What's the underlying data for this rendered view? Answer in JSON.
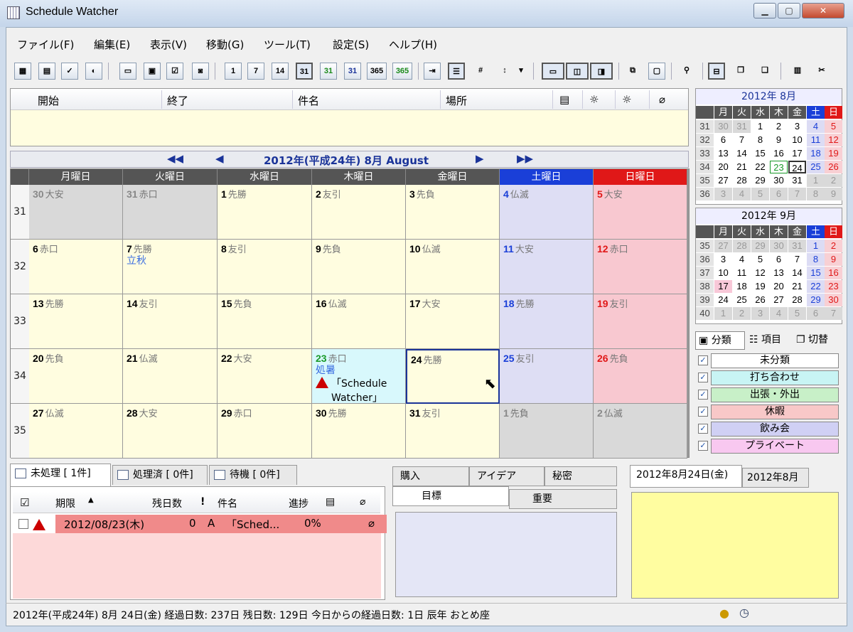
{
  "window": {
    "title": "Schedule Watcher",
    "min": "▁",
    "max": "▢",
    "close": "✕"
  },
  "menu": [
    "ファイル(F)",
    "編集(E)",
    "表示(V)",
    "移動(G)",
    "ツール(T)",
    "設定(S)",
    "ヘルプ(H)"
  ],
  "toolbar": [
    "1",
    "7",
    "14",
    "31",
    "31",
    "31",
    "365",
    "365"
  ],
  "eventlist": {
    "headers": [
      "開始",
      "終了",
      "件名",
      "場所"
    ]
  },
  "nav": {
    "title": "2012年(平成24年) 8月 August",
    "prev_year": "◀◀",
    "prev": "◀",
    "next": "▶",
    "next_year": "▶▶"
  },
  "calendar": {
    "weekdays": [
      "月曜日",
      "火曜日",
      "水曜日",
      "木曜日",
      "金曜日",
      "土曜日",
      "日曜日"
    ],
    "weeks": [
      "31",
      "32",
      "33",
      "34",
      "35"
    ],
    "days": [
      [
        {
          "n": "30",
          "r": "大安"
        },
        {
          "n": "31",
          "r": "赤口"
        },
        {
          "n": "1",
          "r": "先勝"
        },
        {
          "n": "2",
          "r": "友引"
        },
        {
          "n": "3",
          "r": "先負"
        },
        {
          "n": "4",
          "r": "仏滅"
        },
        {
          "n": "5",
          "r": "大安"
        }
      ],
      [
        {
          "n": "6",
          "r": "赤口"
        },
        {
          "n": "7",
          "r": "先勝",
          "h": "立秋"
        },
        {
          "n": "8",
          "r": "友引"
        },
        {
          "n": "9",
          "r": "先負"
        },
        {
          "n": "10",
          "r": "仏滅"
        },
        {
          "n": "11",
          "r": "大安"
        },
        {
          "n": "12",
          "r": "赤口"
        }
      ],
      [
        {
          "n": "13",
          "r": "先勝"
        },
        {
          "n": "14",
          "r": "友引"
        },
        {
          "n": "15",
          "r": "先負"
        },
        {
          "n": "16",
          "r": "仏滅"
        },
        {
          "n": "17",
          "r": "大安"
        },
        {
          "n": "18",
          "r": "先勝"
        },
        {
          "n": "19",
          "r": "友引"
        }
      ],
      [
        {
          "n": "20",
          "r": "先負"
        },
        {
          "n": "21",
          "r": "仏滅"
        },
        {
          "n": "22",
          "r": "大安"
        },
        {
          "n": "23",
          "r": "赤口",
          "h": "処暑",
          "e": "「Schedule",
          "e2": "Watcher」"
        },
        {
          "n": "24",
          "r": "先勝"
        },
        {
          "n": "25",
          "r": "友引"
        },
        {
          "n": "26",
          "r": "先負"
        }
      ],
      [
        {
          "n": "27",
          "r": "仏滅"
        },
        {
          "n": "28",
          "r": "大安"
        },
        {
          "n": "29",
          "r": "赤口"
        },
        {
          "n": "30",
          "r": "先勝"
        },
        {
          "n": "31",
          "r": "友引"
        },
        {
          "n": "1",
          "r": "先負"
        },
        {
          "n": "2",
          "r": "仏滅"
        }
      ]
    ]
  },
  "mini1": {
    "title": "2012年 8月",
    "hd": [
      "月",
      "火",
      "水",
      "木",
      "金",
      "土",
      "日"
    ],
    "rows": [
      [
        "31",
        "30",
        "31",
        "1",
        "2",
        "3",
        "4",
        "5"
      ],
      [
        "32",
        "6",
        "7",
        "8",
        "9",
        "10",
        "11",
        "12"
      ],
      [
        "33",
        "13",
        "14",
        "15",
        "16",
        "17",
        "18",
        "19"
      ],
      [
        "34",
        "20",
        "21",
        "22",
        "23",
        "24",
        "25",
        "26"
      ],
      [
        "35",
        "27",
        "28",
        "29",
        "30",
        "31",
        "1",
        "2"
      ],
      [
        "36",
        "3",
        "4",
        "5",
        "6",
        "7",
        "8",
        "9"
      ]
    ]
  },
  "mini2": {
    "title": "2012年 9月",
    "hd": [
      "月",
      "火",
      "水",
      "木",
      "金",
      "土",
      "日"
    ],
    "rows": [
      [
        "35",
        "27",
        "28",
        "29",
        "30",
        "31",
        "1",
        "2"
      ],
      [
        "36",
        "3",
        "4",
        "5",
        "6",
        "7",
        "8",
        "9"
      ],
      [
        "37",
        "10",
        "11",
        "12",
        "13",
        "14",
        "15",
        "16"
      ],
      [
        "38",
        "17",
        "18",
        "19",
        "20",
        "21",
        "22",
        "23"
      ],
      [
        "39",
        "24",
        "25",
        "26",
        "27",
        "28",
        "29",
        "30"
      ],
      [
        "40",
        "1",
        "2",
        "3",
        "4",
        "5",
        "6",
        "7"
      ]
    ]
  },
  "cattabs": [
    "分類",
    "項目",
    "切替"
  ],
  "categories": [
    {
      "label": "未分類",
      "color": "#ffffff"
    },
    {
      "label": "打ち合わせ",
      "color": "#c8f4f4"
    },
    {
      "label": "出張・外出",
      "color": "#c8f0c8"
    },
    {
      "label": "休暇",
      "color": "#f8c8c8"
    },
    {
      "label": "飲み会",
      "color": "#d0d0f4"
    },
    {
      "label": "プライベート",
      "color": "#f8c8f0"
    }
  ],
  "tasks": {
    "tabs": [
      "未処理 [ 1件]",
      "処理済 [ 0件]",
      "待機 [ 0件]"
    ],
    "headers": [
      "期限",
      "残日数",
      "!",
      "件名",
      "進捗"
    ],
    "row": {
      "date": "2012/08/23(木)",
      "remain": "0",
      "pri": "A",
      "name": "「Sched...",
      "progress": "0%"
    }
  },
  "memo": {
    "tabs_top": [
      "購入",
      "アイデア",
      "秘密"
    ],
    "tabs_bottom": [
      "目標",
      "重要"
    ]
  },
  "daynote": {
    "tabs": [
      "2012年8月24日(金)",
      "2012年8月"
    ]
  },
  "status": "2012年(平成24年) 8月 24日(金) 経過日数: 237日 残日数: 129日 今日からの経過日数: 1日 辰年 おとめ座"
}
